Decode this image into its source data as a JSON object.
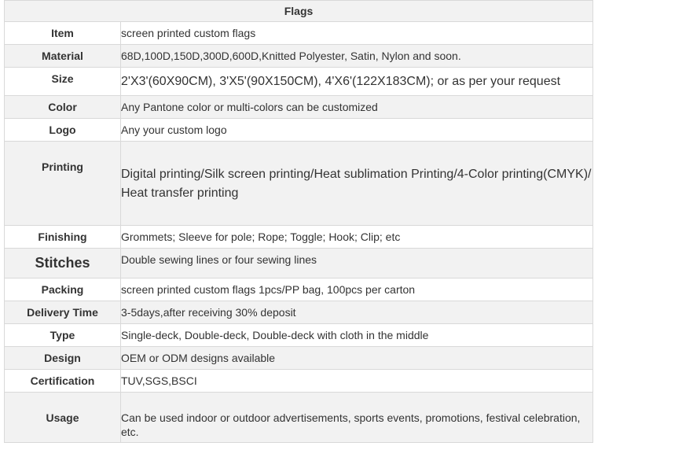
{
  "title": "Flags",
  "rows": [
    {
      "label": "Item",
      "value": "screen printed custom flags"
    },
    {
      "label": "Material",
      "value": "68D,100D,150D,300D,600D,Knitted Polyester, Satin, Nylon and soon."
    },
    {
      "label": "Size",
      "value": "2'X3'(60X90CM), 3'X5'(90X150CM), 4'X6'(122X183CM); or as per your request"
    },
    {
      "label": "Color",
      "value": "Any Pantone color or multi-colors can be customized"
    },
    {
      "label": "Logo",
      "value": "Any your custom logo"
    },
    {
      "label": "Printing",
      "value": "Digital printing/Silk screen printing/Heat sublimation Printing/4-Color printing(CMYK)/ Heat transfer printing"
    },
    {
      "label": "Finishing",
      "value": "Grommets; Sleeve for pole; Rope; Toggle; Hook; Clip; etc"
    },
    {
      "label": "Stitches",
      "value": "Double sewing lines or four sewing lines"
    },
    {
      "label": "Packing",
      "value": "screen printed custom flags 1pcs/PP bag, 100pcs per carton"
    },
    {
      "label": "Delivery Time",
      "value": "3-5days,after receiving 30% deposit"
    },
    {
      "label": "Type",
      "value": "Single-deck, Double-deck, Double-deck with cloth in the middle"
    },
    {
      "label": "Design",
      "value": "OEM or ODM designs available"
    },
    {
      "label": "Certification",
      "value": "TUV,SGS,BSCI"
    },
    {
      "label": "Usage",
      "value": "Can be used indoor or outdoor advertisements, sports events, promotions, festival celebration, etc."
    }
  ]
}
